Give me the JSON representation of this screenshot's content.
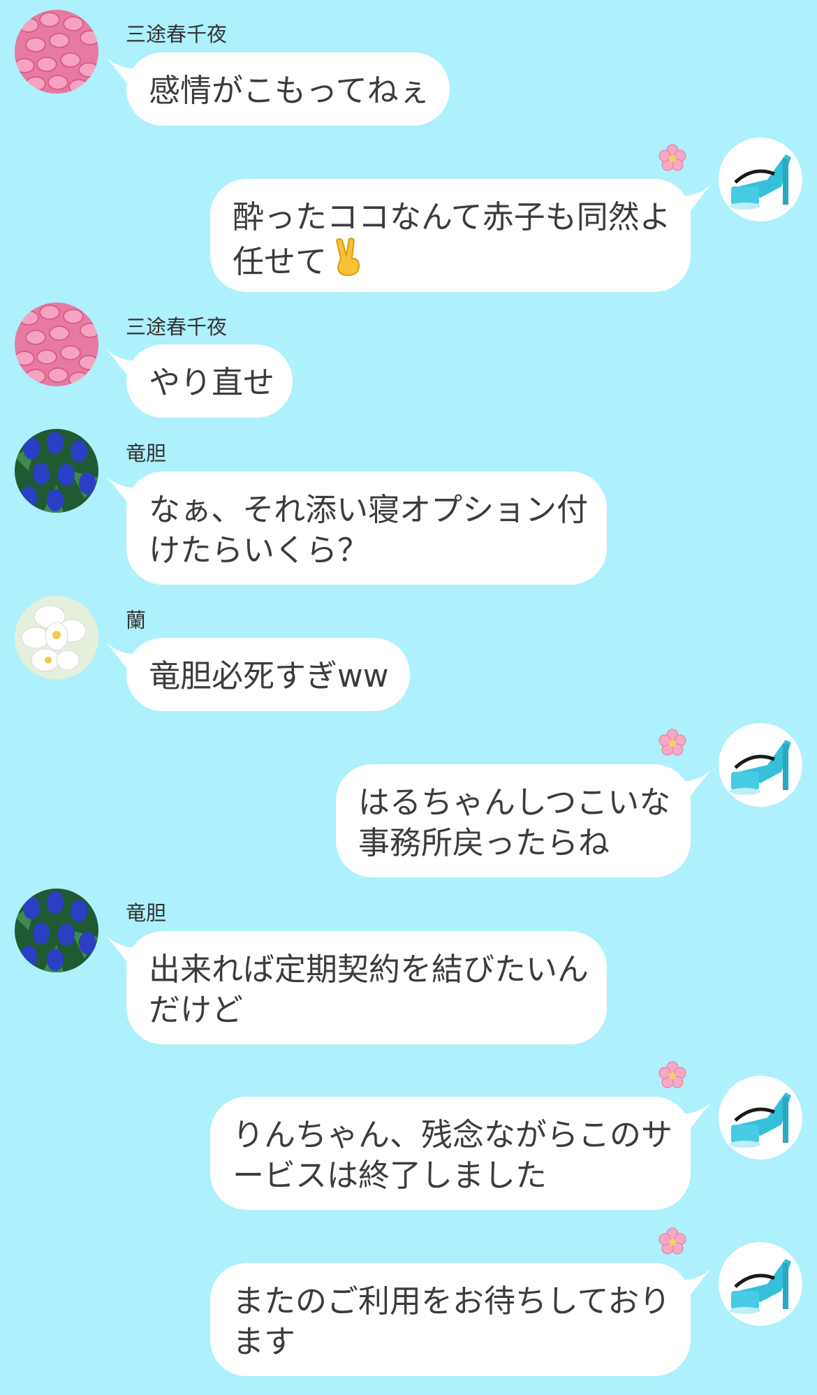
{
  "colors": {
    "background": "#aef0fb",
    "bubble": "#ffffff",
    "text": "#3c3c3c"
  },
  "icons": {
    "pink_pills_avatar": "pink-pills-icon",
    "blue_gentian_avatar": "blue-gentian-icon",
    "white_orchid_avatar": "white-orchid-icon",
    "blue_heel_avatar": "blue-heel-icon",
    "flower": "cherry-blossom-icon",
    "peace": "victory-hand-icon"
  },
  "messages": [
    {
      "side": "left",
      "sender": "三途春千夜",
      "lines": [
        "感情がこもってねぇ"
      ]
    },
    {
      "side": "right",
      "lines": [
        "酔ったココなんて赤子も同然よ",
        "任せて"
      ]
    },
    {
      "side": "left",
      "sender": "三途春千夜",
      "lines": [
        "やり直せ"
      ]
    },
    {
      "side": "left",
      "sender": "竜胆",
      "lines": [
        "なぁ、それ添い寝オプション付",
        "けたらいくら？"
      ]
    },
    {
      "side": "left",
      "sender": "蘭",
      "lines": [
        "竜胆必死すぎww"
      ]
    },
    {
      "side": "right",
      "lines": [
        "はるちゃんしつこいな",
        "事務所戻ったらね"
      ]
    },
    {
      "side": "left",
      "sender": "竜胆",
      "lines": [
        "出来れば定期契約を結びたいん",
        "だけど"
      ]
    },
    {
      "side": "right",
      "lines": [
        "りんちゃん、残念ながらこのサ",
        "ービスは終了しました"
      ]
    },
    {
      "side": "right",
      "lines": [
        "またのご利用をお待ちしており",
        "ます"
      ]
    }
  ]
}
